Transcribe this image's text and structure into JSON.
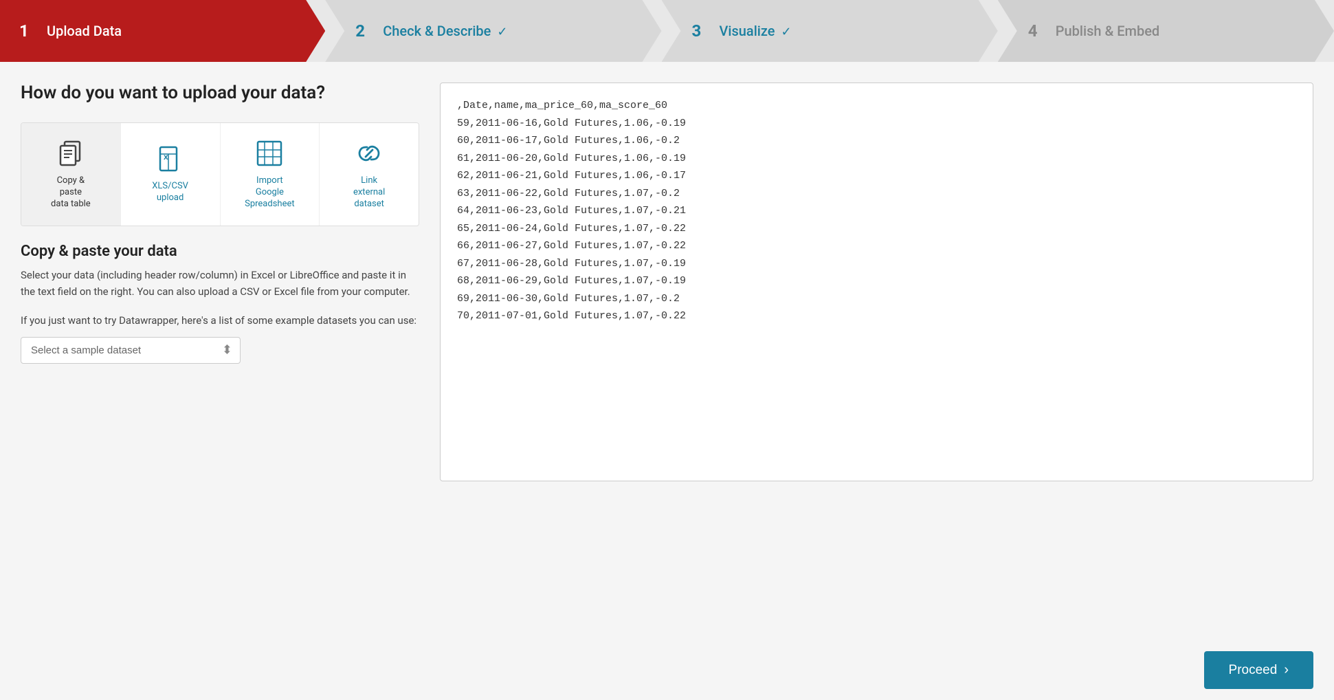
{
  "wizard": {
    "steps": [
      {
        "id": "step-1",
        "number": "1",
        "label": "Upload Data",
        "state": "active",
        "check": false
      },
      {
        "id": "step-2",
        "number": "2",
        "label": "Check & Describe",
        "state": "done",
        "check": true
      },
      {
        "id": "step-3",
        "number": "3",
        "label": "Visualize",
        "state": "done",
        "check": true
      },
      {
        "id": "step-4",
        "number": "4",
        "label": "Publish & Embed",
        "state": "inactive",
        "check": false
      }
    ]
  },
  "upload_section": {
    "question": "How do you want to upload your data?",
    "methods": [
      {
        "id": "copy-paste",
        "label": "Copy &\npaste\ndata table",
        "active": true
      },
      {
        "id": "xls-csv",
        "label": "XLS/CSV\nupload",
        "active": false
      },
      {
        "id": "google-sheet",
        "label": "Import\nGoogle\nSpreadsheet",
        "active": false
      },
      {
        "id": "link-external",
        "label": "Link\nexternal\ndataset",
        "active": false
      }
    ]
  },
  "copy_paste_section": {
    "title": "Copy & paste your data",
    "description": "Select your data (including header row/column) in Excel or LibreOffice and paste it in the text field on the right. You can also upload a CSV or Excel file from your computer.",
    "sample_intro": "If you just want to try Datawrapper, here's a list of some example datasets you can use:",
    "sample_placeholder": "Select a sample dataset",
    "sample_options": [
      "Select a sample dataset"
    ]
  },
  "data_preview": {
    "content": ",Date,name,ma_price_60,ma_score_60\n59,2011-06-16,Gold Futures,1.06,-0.19\n60,2011-06-17,Gold Futures,1.06,-0.2\n61,2011-06-20,Gold Futures,1.06,-0.19\n62,2011-06-21,Gold Futures,1.06,-0.17\n63,2011-06-22,Gold Futures,1.07,-0.2\n64,2011-06-23,Gold Futures,1.07,-0.21\n65,2011-06-24,Gold Futures,1.07,-0.22\n66,2011-06-27,Gold Futures,1.07,-0.22\n67,2011-06-28,Gold Futures,1.07,-0.19\n68,2011-06-29,Gold Futures,1.07,-0.19\n69,2011-06-30,Gold Futures,1.07,-0.2\n70,2011-07-01,Gold Futures,1.07,-0.22"
  },
  "footer": {
    "proceed_label": "Proceed",
    "proceed_arrow": "›"
  }
}
